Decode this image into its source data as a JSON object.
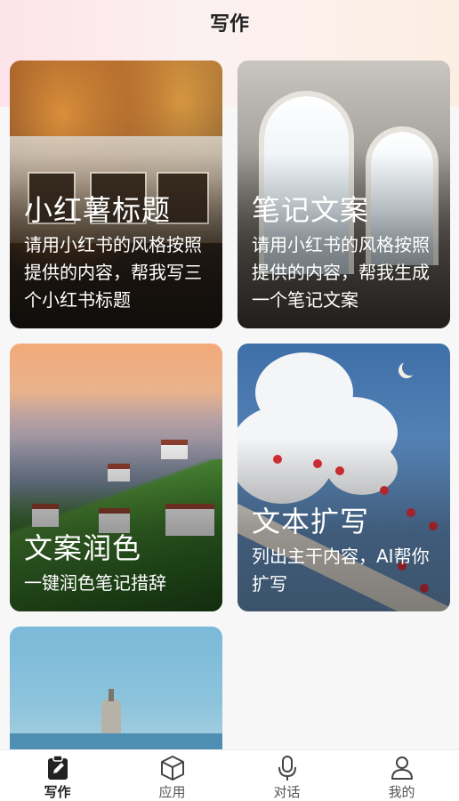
{
  "header": {
    "title": "写作"
  },
  "cards": [
    {
      "title": "小红薯标题",
      "description": "请用小红书的风格按照提供的内容，帮我写三个小红书标题"
    },
    {
      "title": "笔记文案",
      "description": "请用小红书的风格按照提供的内容，帮我生成一个笔记文案"
    },
    {
      "title": "文案润色",
      "description": "一键润色笔记措辞"
    },
    {
      "title": "文本扩写",
      "description": "列出主干内容，AI帮你扩写"
    },
    {
      "title": "",
      "description": ""
    }
  ],
  "tabbar": {
    "items": [
      {
        "label": "写作",
        "icon": "edit-document-icon",
        "active": true
      },
      {
        "label": "应用",
        "icon": "cube-icon",
        "active": false
      },
      {
        "label": "对话",
        "icon": "microphone-icon",
        "active": false
      },
      {
        "label": "我的",
        "icon": "person-icon",
        "active": false
      }
    ]
  },
  "colors": {
    "active": "#222222",
    "inactive": "#555555",
    "header_gradient": "#fde3ea"
  }
}
